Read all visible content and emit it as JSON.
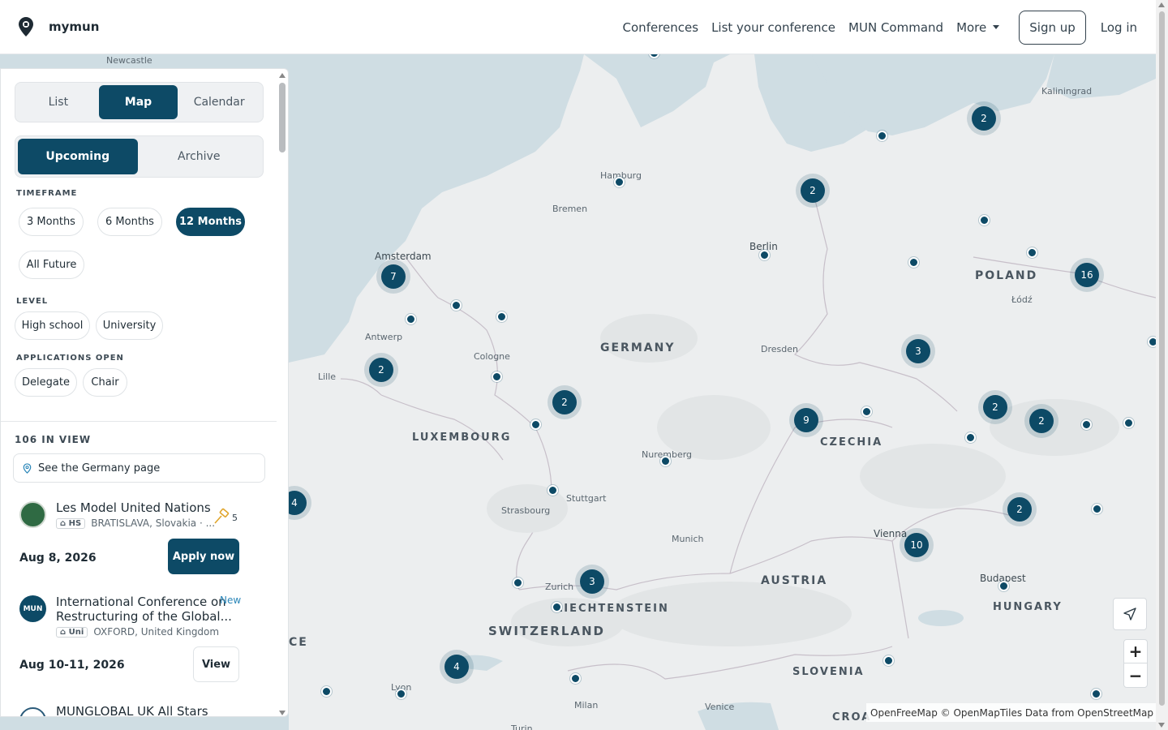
{
  "brand": {
    "name": "mymun"
  },
  "nav": {
    "links": [
      "Conferences",
      "List your conference",
      "MUN Command",
      "More"
    ],
    "signup": "Sign up",
    "login": "Log in"
  },
  "view_tabs": [
    "List",
    "Map",
    "Calendar"
  ],
  "active_view": "Map",
  "time_tabs": [
    "Upcoming",
    "Archive"
  ],
  "active_time_tab": "Upcoming",
  "timeframe": {
    "label": "TIMEFRAME",
    "options": [
      "3 Months",
      "6 Months",
      "12 Months",
      "All Future"
    ],
    "active": "12 Months"
  },
  "level": {
    "label": "LEVEL",
    "options": [
      "High school",
      "University"
    ]
  },
  "applications": {
    "label": "APPLICATIONS OPEN",
    "options": [
      "Delegate",
      "Chair"
    ]
  },
  "results": {
    "count_label": "106 IN VIEW",
    "country_link": "See the Germany page"
  },
  "conferences": [
    {
      "name": "Les Model United Nations",
      "tag": "HS",
      "location": "BRATISLAVA, Slovakia · ...",
      "gavel_count": "5",
      "date": "Aug 8, 2026",
      "action": "Apply now"
    },
    {
      "name_line1": "International Conference on",
      "name_line2": "Restructuring of the Global...",
      "logo_text": "MUN",
      "badge": "New",
      "tag": "Uni",
      "location": "OXFORD, United Kingdom",
      "date": "Aug 10-11, 2026",
      "action": "View"
    },
    {
      "name": "MUNGLOBAL UK All Stars"
    }
  ],
  "map": {
    "cities": [
      "Newcastle",
      "Kaliningrad",
      "Hamburg",
      "Bremen",
      "Berlin",
      "Amsterdam",
      "Antwerp",
      "Cologne",
      "Lille",
      "Dresden",
      "Łódź",
      "Nuremberg",
      "Stuttgart",
      "Strasbourg",
      "Munich",
      "Zurich",
      "Vienna",
      "Budapest",
      "Lyon",
      "Milan",
      "Venice",
      "Turin"
    ],
    "countries": [
      "POLAND",
      "GERMANY",
      "LUXEMBOURG",
      "CZECHIA",
      "AUSTRIA",
      "LIECHTENSTEIN",
      "SWITZERLAND",
      "HUNGARY",
      "SLOVENIA",
      "CE",
      "CROA"
    ],
    "clusters": [
      "2",
      "2",
      "7",
      "16",
      "2",
      "3",
      "2",
      "9",
      "2",
      "2",
      "4",
      "2",
      "3",
      "10",
      "4"
    ],
    "attribution": "OpenFreeMap © OpenMapTiles Data from OpenStreetMap",
    "zoom_in": "+",
    "zoom_out": "−"
  },
  "colors": {
    "primary": "#0d4a66",
    "sea": "#cfdde3",
    "land": "#eceeef"
  }
}
